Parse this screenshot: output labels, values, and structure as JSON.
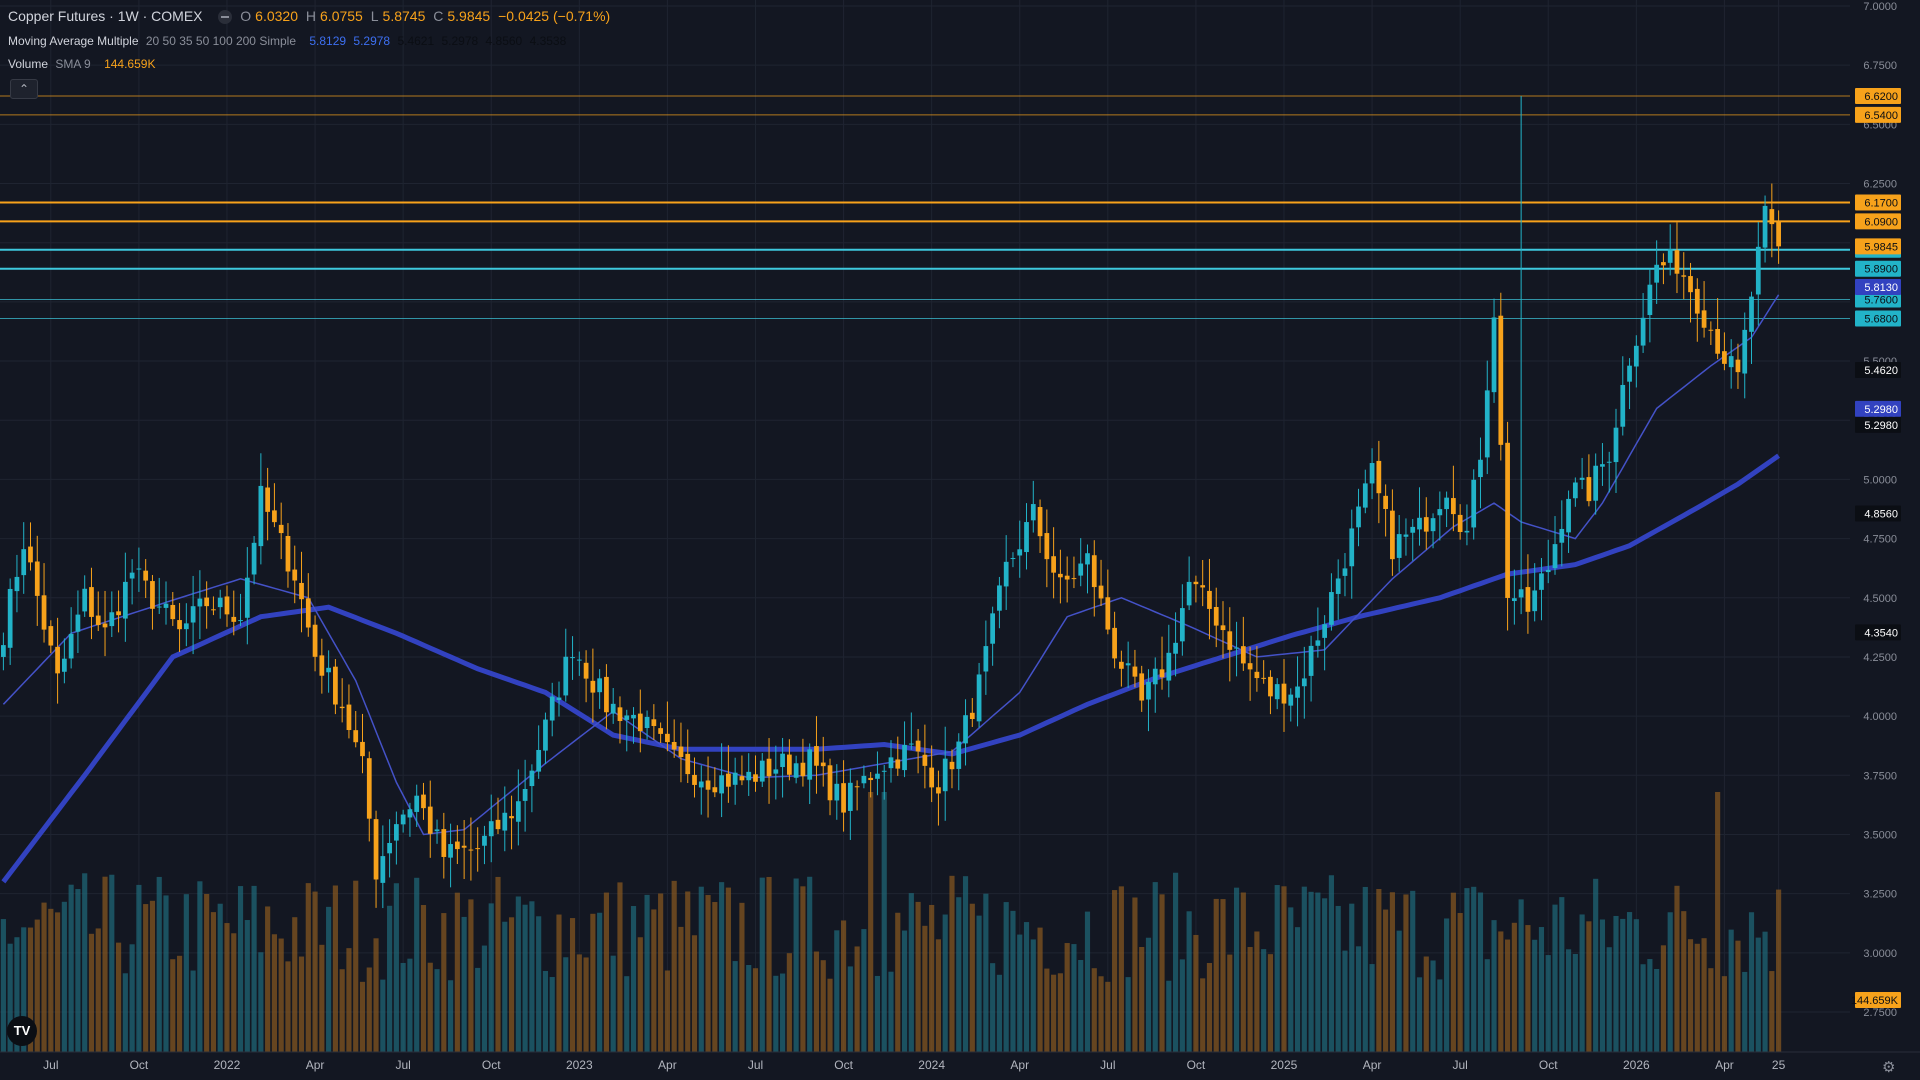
{
  "header": {
    "symbol_title": "Copper Futures · 1W · COMEX",
    "open_label": "O",
    "open": "6.0320",
    "high_label": "H",
    "high": "6.0755",
    "low_label": "L",
    "low": "5.8745",
    "close_label": "C",
    "close": "5.9845",
    "change": "−0.0425 (−0.71%)",
    "ma_name": "Moving Average Multiple",
    "ma_params": "20 50 35 50 100 200 Simple",
    "ma_values": [
      "5.8129",
      "5.2978",
      "5.4621",
      "5.2978",
      "4.8560",
      "4.3538"
    ],
    "vol_name": "Volume",
    "vol_params": "SMA 9",
    "vol_value": "144.659K",
    "collapse_icon": "chevron-up-icon",
    "logo": "TV"
  },
  "colors": {
    "bg": "#131722",
    "grid": "#1f2431",
    "up": "#22b3c8",
    "down": "#f7a21b",
    "orange_line": "#f7a21b",
    "cyan_line": "#3ec9de",
    "ma_fast": "#4452c8",
    "ma_slow": "#3242c0",
    "text": "#b2b5be"
  },
  "chart_data": {
    "type": "candlestick",
    "ylim": [
      2.6,
      7.0
    ],
    "y_ticks": [
      "7.0000",
      "6.7500",
      "6.5000",
      "6.2500",
      "6.0000",
      "5.7500",
      "5.5000",
      "5.2500",
      "5.0000",
      "4.7500",
      "4.5000",
      "4.2500",
      "4.0000",
      "3.7500",
      "3.5000",
      "3.2500",
      "3.0000",
      "2.7500"
    ],
    "x_ticks": [
      "Jul",
      "Oct",
      "2022",
      "Apr",
      "Jul",
      "Oct",
      "2023",
      "Apr",
      "Jul",
      "Oct",
      "2024",
      "Apr",
      "Jul",
      "Oct",
      "2025",
      "Apr",
      "Jul",
      "Oct",
      "2026",
      "Apr",
      "25"
    ],
    "horizontal_levels": [
      {
        "value": 6.62,
        "label": "6.6200",
        "style": "orange-thin"
      },
      {
        "value": 6.54,
        "label": "6.5400",
        "style": "orange-thin"
      },
      {
        "value": 6.17,
        "label": "6.1700",
        "style": "orange"
      },
      {
        "value": 6.09,
        "label": "6.0900",
        "style": "orange"
      },
      {
        "value": 5.97,
        "label": "5.9700",
        "style": "cyan"
      },
      {
        "value": 5.89,
        "label": "5.8900",
        "style": "cyan"
      },
      {
        "value": 5.76,
        "label": "5.7600",
        "style": "cyan-thin"
      },
      {
        "value": 5.68,
        "label": "5.6800",
        "style": "cyan-thin"
      }
    ],
    "price_labels": [
      {
        "value": 5.9845,
        "label": "5.9845",
        "style": "orange"
      },
      {
        "value": 5.8129,
        "label": "5.8130",
        "style": "blue"
      },
      {
        "value": 5.4621,
        "label": "5.4620",
        "style": "black"
      },
      {
        "value": 5.2978,
        "label": "5.2980",
        "style": "blue"
      },
      {
        "value": 5.2978,
        "label": "5.2980",
        "style": "black"
      },
      {
        "value": 4.856,
        "label": "4.8560",
        "style": "black"
      },
      {
        "value": 4.3538,
        "label": "4.3540",
        "style": "black"
      }
    ],
    "volume_label": "144.659K",
    "close_anchors": [
      [
        0,
        4.36
      ],
      [
        3,
        4.74
      ],
      [
        8,
        4.15
      ],
      [
        12,
        4.5
      ],
      [
        15,
        4.35
      ],
      [
        19,
        4.61
      ],
      [
        26,
        4.35
      ],
      [
        30,
        4.48
      ],
      [
        35,
        4.43
      ],
      [
        38,
        4.92
      ],
      [
        43,
        4.6
      ],
      [
        46,
        4.26
      ],
      [
        50,
        4.05
      ],
      [
        53,
        3.78
      ],
      [
        55,
        3.35
      ],
      [
        58,
        3.56
      ],
      [
        61,
        3.66
      ],
      [
        65,
        3.41
      ],
      [
        70,
        3.44
      ],
      [
        76,
        3.63
      ],
      [
        80,
        3.95
      ],
      [
        84,
        4.3
      ],
      [
        89,
        4.05
      ],
      [
        94,
        3.98
      ],
      [
        99,
        3.81
      ],
      [
        104,
        3.74
      ],
      [
        109,
        3.73
      ],
      [
        114,
        3.79
      ],
      [
        119,
        3.81
      ],
      [
        124,
        3.63
      ],
      [
        129,
        3.79
      ],
      [
        134,
        3.86
      ],
      [
        138,
        3.72
      ],
      [
        141,
        3.87
      ],
      [
        144,
        4.13
      ],
      [
        148,
        4.62
      ],
      [
        152,
        4.85
      ],
      [
        156,
        4.54
      ],
      [
        160,
        4.66
      ],
      [
        164,
        4.28
      ],
      [
        168,
        4.05
      ],
      [
        172,
        4.25
      ],
      [
        175,
        4.56
      ],
      [
        179,
        4.42
      ],
      [
        183,
        4.22
      ],
      [
        187,
        4.1
      ],
      [
        191,
        4.12
      ],
      [
        195,
        4.42
      ],
      [
        199,
        4.76
      ],
      [
        202,
        5.02
      ],
      [
        205,
        4.72
      ],
      [
        209,
        4.79
      ],
      [
        213,
        4.97
      ],
      [
        216,
        4.77
      ],
      [
        218,
        5.12
      ],
      [
        220,
        5.72
      ],
      [
        222,
        4.53
      ],
      [
        225,
        4.45
      ],
      [
        228,
        4.63
      ],
      [
        231,
        4.95
      ],
      [
        234,
        4.95
      ],
      [
        237,
        5.12
      ],
      [
        240,
        5.52
      ],
      [
        244,
        5.9
      ],
      [
        247,
        5.92
      ],
      [
        250,
        5.76
      ],
      [
        254,
        5.52
      ],
      [
        256,
        5.42
      ],
      [
        258,
        5.78
      ],
      [
        260,
        6.1
      ],
      [
        262,
        5.985
      ]
    ],
    "sma_fast_anchors": [
      [
        0,
        4.05
      ],
      [
        10,
        4.35
      ],
      [
        25,
        4.49
      ],
      [
        35,
        4.58
      ],
      [
        45,
        4.5
      ],
      [
        52,
        4.15
      ],
      [
        58,
        3.72
      ],
      [
        62,
        3.5
      ],
      [
        68,
        3.52
      ],
      [
        80,
        3.8
      ],
      [
        90,
        4.02
      ],
      [
        100,
        3.82
      ],
      [
        110,
        3.74
      ],
      [
        120,
        3.75
      ],
      [
        130,
        3.8
      ],
      [
        140,
        3.85
      ],
      [
        150,
        4.1
      ],
      [
        157,
        4.42
      ],
      [
        165,
        4.5
      ],
      [
        175,
        4.38
      ],
      [
        185,
        4.25
      ],
      [
        195,
        4.28
      ],
      [
        205,
        4.58
      ],
      [
        214,
        4.8
      ],
      [
        220,
        4.9
      ],
      [
        224,
        4.82
      ],
      [
        232,
        4.75
      ],
      [
        236,
        4.9
      ],
      [
        244,
        5.3
      ],
      [
        252,
        5.48
      ],
      [
        258,
        5.6
      ],
      [
        262,
        5.78
      ]
    ],
    "sma_slow_anchors": [
      [
        0,
        3.3
      ],
      [
        12,
        3.75
      ],
      [
        25,
        4.25
      ],
      [
        38,
        4.42
      ],
      [
        48,
        4.46
      ],
      [
        58,
        4.35
      ],
      [
        70,
        4.2
      ],
      [
        80,
        4.1
      ],
      [
        90,
        3.92
      ],
      [
        100,
        3.86
      ],
      [
        110,
        3.86
      ],
      [
        120,
        3.86
      ],
      [
        130,
        3.88
      ],
      [
        140,
        3.84
      ],
      [
        150,
        3.92
      ],
      [
        160,
        4.05
      ],
      [
        170,
        4.16
      ],
      [
        180,
        4.25
      ],
      [
        190,
        4.34
      ],
      [
        200,
        4.42
      ],
      [
        212,
        4.5
      ],
      [
        222,
        4.6
      ],
      [
        232,
        4.64
      ],
      [
        240,
        4.72
      ],
      [
        250,
        4.88
      ],
      [
        256,
        4.98
      ],
      [
        262,
        5.1
      ]
    ]
  }
}
